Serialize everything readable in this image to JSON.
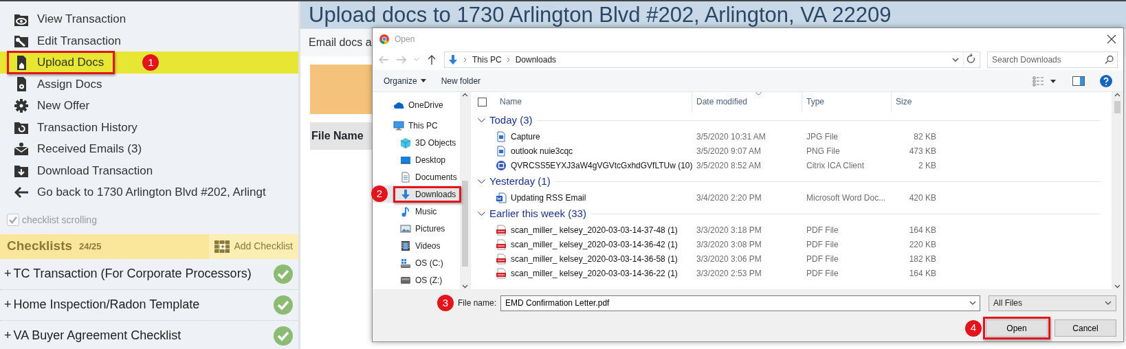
{
  "sidebar": {
    "menu": [
      {
        "label": "View Transaction",
        "kind": "view",
        "selected": false,
        "highlighted": false
      },
      {
        "label": "Edit Transaction",
        "kind": "edit",
        "selected": false,
        "highlighted": false
      },
      {
        "label": "Upload Docs",
        "kind": "upload",
        "selected": true,
        "highlighted": true,
        "callout": "1"
      },
      {
        "label": "Assign Docs",
        "kind": "assign",
        "selected": false,
        "highlighted": false
      },
      {
        "label": "New Offer",
        "kind": "offer",
        "selected": false,
        "highlighted": false
      },
      {
        "label": "Transaction History",
        "kind": "history",
        "selected": false,
        "highlighted": false
      },
      {
        "label": "Received Emails (3)",
        "kind": "email",
        "selected": false,
        "highlighted": false
      },
      {
        "label": "Download Transaction",
        "kind": "download",
        "selected": false,
        "highlighted": false
      },
      {
        "label": "Go back to 1730 Arlington Blvd #202, Arlingt",
        "kind": "back",
        "selected": false,
        "highlighted": false
      }
    ],
    "checklist_scrolling": {
      "label": "checklist scrolling",
      "checked": true
    },
    "checklists": {
      "title": "Checklists",
      "count": "24/25",
      "add_label": "Add Checklist",
      "items": [
        {
          "expander": "+",
          "label": "TC Transaction (For Corporate Processors)",
          "complete": true
        },
        {
          "expander": "+",
          "label": "Home Inspection/Radon Template",
          "complete": true
        },
        {
          "expander": "+",
          "label": "VA Buyer Agreement Checklist",
          "complete": true
        }
      ]
    }
  },
  "page": {
    "title": "Upload docs to 1730 Arlington Blvd #202, Arlington, VA 22209",
    "subtitle": "Email docs a",
    "column": "File Name"
  },
  "dialog": {
    "title": "Open",
    "breadcrumb": [
      "This PC",
      "Downloads"
    ],
    "search_placeholder": "Search Downloads",
    "toolbar": [
      "Organize",
      "New folder"
    ],
    "nav": [
      {
        "label": "OneDrive",
        "kind": "cloud",
        "selected": false,
        "highlighted": false
      },
      {
        "label": "This PC",
        "kind": "computer",
        "selected": false,
        "highlighted": false,
        "children": [
          {
            "label": "3D Objects",
            "kind": "cube",
            "selected": false,
            "highlighted": false
          },
          {
            "label": "Desktop",
            "kind": "desktop",
            "selected": false,
            "highlighted": false
          },
          {
            "label": "Documents",
            "kind": "document",
            "selected": false,
            "highlighted": false
          },
          {
            "label": "Downloads",
            "kind": "download",
            "selected": true,
            "highlighted": true,
            "callout": "2"
          },
          {
            "label": "Music",
            "kind": "music",
            "selected": false,
            "highlighted": false
          },
          {
            "label": "Pictures",
            "kind": "pictures",
            "selected": false,
            "highlighted": false
          },
          {
            "label": "Videos",
            "kind": "videos",
            "selected": false,
            "highlighted": false
          },
          {
            "label": "OS (C:)",
            "kind": "system_drive",
            "selected": false,
            "highlighted": false
          },
          {
            "label": "OS (Z:)",
            "kind": "drive",
            "selected": false,
            "highlighted": false
          }
        ]
      }
    ],
    "columns": [
      "Name",
      "Date modified",
      "Type",
      "Size"
    ],
    "groups": [
      {
        "label": "Today (3)",
        "files": [
          {
            "name": "Capture",
            "kind": "image",
            "date": "3/5/2020 10:31 AM",
            "type": "JPG File",
            "size": "82 KB"
          },
          {
            "name": "outlook nuie3cqc",
            "kind": "image",
            "date": "3/5/2020 9:07 AM",
            "type": "PNG File",
            "size": "473 KB"
          },
          {
            "name": "QVRCSS5EYXJ3aW4gVGVtcGxhdGVfLTUw (10)",
            "kind": "citrix",
            "date": "3/5/2020 8:52 AM",
            "type": "Citrix ICA Client",
            "size": "2 KB"
          }
        ]
      },
      {
        "label": "Yesterday (1)",
        "files": [
          {
            "name": "Updating RSS Email",
            "kind": "word",
            "date": "3/4/2020 2:20 PM",
            "type": "Microsoft Word Doc...",
            "size": "420 KB"
          }
        ]
      },
      {
        "label": "Earlier this week (33)",
        "files": [
          {
            "name": "scan_miller_ kelsey_2020-03-03-14-37-48 (1)",
            "kind": "pdf",
            "date": "3/3/2020 3:18 PM",
            "type": "PDF File",
            "size": "164 KB"
          },
          {
            "name": "scan_miller_ kelsey_2020-03-03-14-36-42 (1)",
            "kind": "pdf",
            "date": "3/3/2020 3:08 PM",
            "type": "PDF File",
            "size": "220 KB"
          },
          {
            "name": "scan_miller_ kelsey_2020-03-03-14-36-58 (1)",
            "kind": "pdf",
            "date": "3/3/2020 3:06 PM",
            "type": "PDF File",
            "size": "182 KB"
          },
          {
            "name": "scan_miller_ kelsey_2020-03-03-14-36-22 (1)",
            "kind": "pdf",
            "date": "3/3/2020 2:53 PM",
            "type": "PDF File",
            "size": "164 KB"
          }
        ]
      }
    ],
    "file_name_label": "File name:",
    "file_name": "EMD Confirmation Letter.pdf",
    "file_name_callout": "3",
    "file_type": "All Files",
    "buttons": [
      {
        "label": "Open",
        "highlighted": true,
        "callout": "4"
      },
      {
        "label": "Cancel",
        "highlighted": false
      }
    ]
  }
}
